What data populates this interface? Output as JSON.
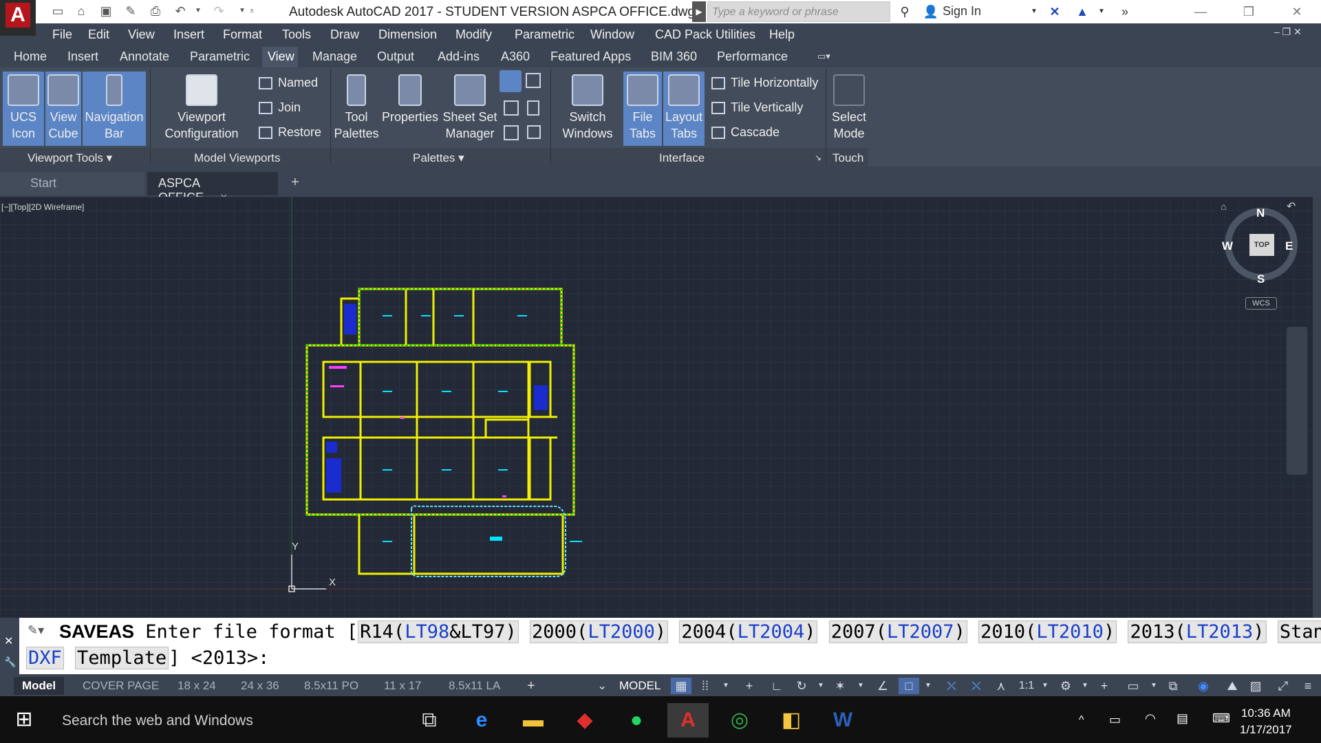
{
  "app": {
    "title": "Autodesk AutoCAD 2017 - STUDENT VERSION    ASPCA OFFICE.dwg",
    "logo_letter": "A",
    "search_placeholder": "Type a keyword or phrase",
    "sign_in": "Sign In"
  },
  "menu": [
    "File",
    "Edit",
    "View",
    "Insert",
    "Format",
    "Tools",
    "Draw",
    "Dimension",
    "Modify",
    "Parametric",
    "Window",
    "CAD Pack Utilities",
    "Help"
  ],
  "ribbon_tabs": [
    "Home",
    "Insert",
    "Annotate",
    "Parametric",
    "View",
    "Manage",
    "Output",
    "Add-ins",
    "A360",
    "Featured Apps",
    "BIM 360",
    "Performance"
  ],
  "active_ribbon_tab": "View",
  "ribbon": {
    "viewport_tools": {
      "title": "Viewport Tools",
      "ucs_icon": "UCS Icon",
      "view_cube": "View Cube",
      "navigation_bar": "Navigation Bar"
    },
    "model_viewports": {
      "title": "Model Viewports",
      "viewport_configuration": "Viewport Configuration",
      "named": "Named",
      "join": "Join",
      "restore": "Restore"
    },
    "palettes": {
      "title": "Palettes",
      "tool_palettes": "Tool Palettes",
      "properties": "Properties",
      "sheet_set_manager": "Sheet Set Manager"
    },
    "interface": {
      "title": "Interface",
      "switch_windows": "Switch Windows",
      "file_tabs": "File Tabs",
      "layout_tabs": "Layout Tabs",
      "tile_horizontally": "Tile Horizontally",
      "tile_vertically": "Tile Vertically",
      "cascade": "Cascade"
    },
    "touch": {
      "title": "Touch",
      "select_mode": "Select Mode"
    }
  },
  "file_tabs": {
    "start": "Start",
    "current": "ASPCA OFFICE",
    "close": "×",
    "add": "+"
  },
  "viewport_label": "[−][Top][2D Wireframe]",
  "viewcube": {
    "top": "TOP",
    "n": "N",
    "s": "S",
    "e": "E",
    "w": "W",
    "wcs": "WCS"
  },
  "ucs": {
    "x": "X",
    "y": "Y"
  },
  "command": {
    "name": "SAVEAS",
    "prompt": "Enter file format",
    "options": [
      {
        "main": "R14(",
        "alt": "LT98",
        "mid": "&LT97",
        "end": ")"
      },
      {
        "main": "2000(",
        "alt": "LT2000",
        "mid": "",
        "end": ")"
      },
      {
        "main": "2004(",
        "alt": "LT2004",
        "mid": "",
        "end": ")"
      },
      {
        "main": "2007(",
        "alt": "LT2007",
        "mid": "",
        "end": ")"
      },
      {
        "main": "2010(",
        "alt": "LT2010",
        "mid": "",
        "end": ")"
      },
      {
        "main": "2013(",
        "alt": "LT2013",
        "mid": "",
        "end": ")"
      }
    ],
    "standards": "Standards",
    "dxf": "DXF",
    "template": "Template",
    "default": "] <2013>:"
  },
  "layout_tabs": [
    "Model",
    "COVER PAGE",
    "18 x 24",
    "24 x 36",
    "8.5x11 PO",
    "11 x 17",
    "8.5x11 LA"
  ],
  "status": {
    "model": "MODEL",
    "scale": "1:1"
  },
  "taskbar": {
    "search": "Search the web and Windows",
    "time": "10:36 AM",
    "date": "1/17/2017"
  },
  "colors": {
    "accent": "#5b85c4",
    "canvas": "#232936",
    "walls": "#f0f000",
    "fixtures": "#00e000",
    "blue_fill": "#1a2cd0"
  }
}
